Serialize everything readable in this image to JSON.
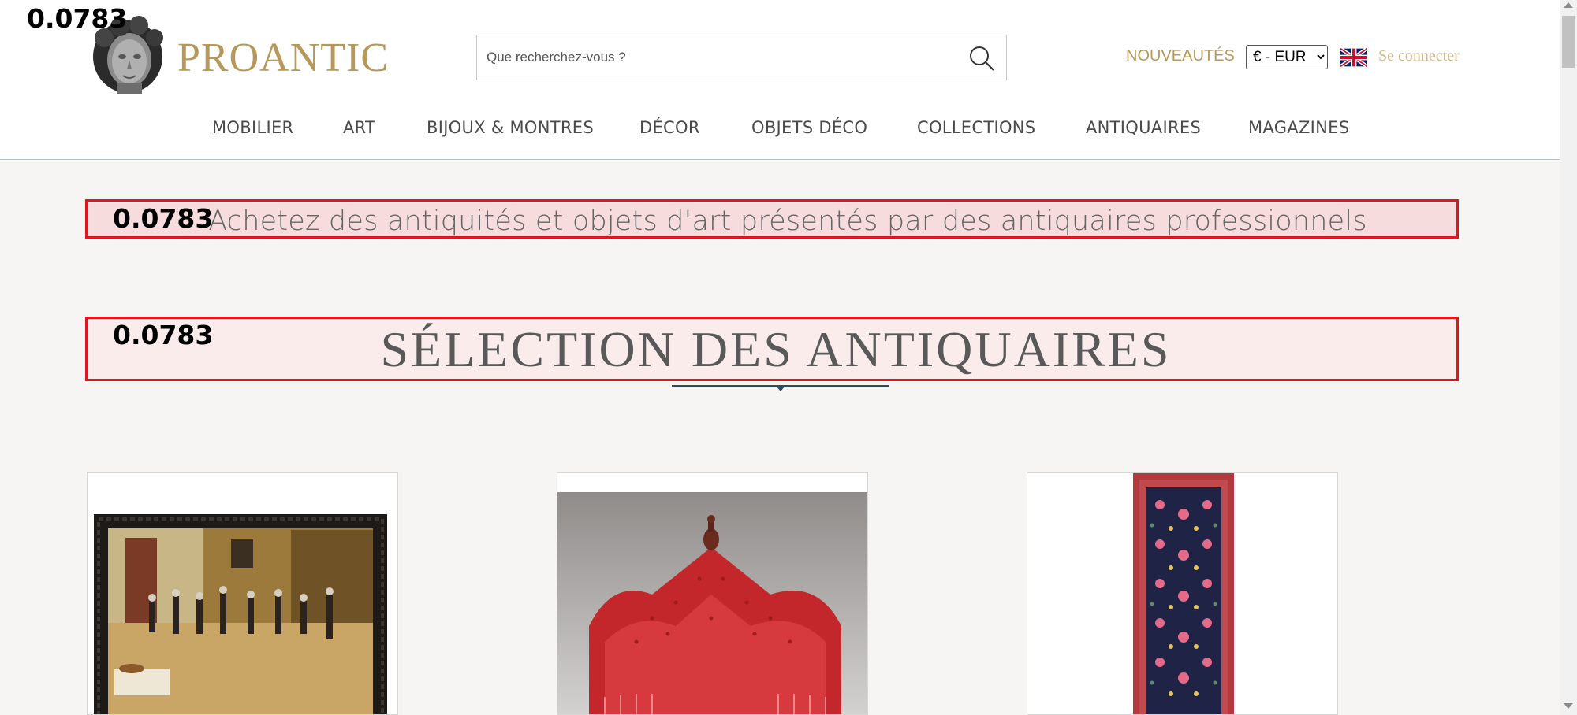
{
  "debug_score": "0.0783",
  "brand": {
    "name": "PROANTIC",
    "color": "#b6985b"
  },
  "search": {
    "placeholder": "Que recherchez-vous ?"
  },
  "header_links": {
    "new_label": "NOUVEAUTÉS",
    "login_label": "Se connecter"
  },
  "currency": {
    "selected": "€ - EUR",
    "options": [
      "€ - EUR"
    ]
  },
  "nav": {
    "items": [
      {
        "label": "MOBILIER"
      },
      {
        "label": "ART"
      },
      {
        "label": "BIJOUX & MONTRES"
      },
      {
        "label": "DÉCOR"
      },
      {
        "label": "OBJETS DÉCO"
      },
      {
        "label": "COLLECTIONS"
      },
      {
        "label": "ANTIQUAIRES"
      },
      {
        "label": "MAGAZINES"
      }
    ]
  },
  "tagline": "Achetez des antiquités et objets d'art présentés par des antiquaires professionnels",
  "section": {
    "title": "SÉLECTION DES ANTIQUAIRES"
  },
  "products": [
    {
      "icon": "framed-painting-image"
    },
    {
      "icon": "red-velvet-sofa-image"
    },
    {
      "icon": "persian-rug-image"
    }
  ],
  "colors": {
    "accent_red": "#e2141c",
    "nav_text": "#4a4a4a",
    "rule": "#2d4a63"
  }
}
